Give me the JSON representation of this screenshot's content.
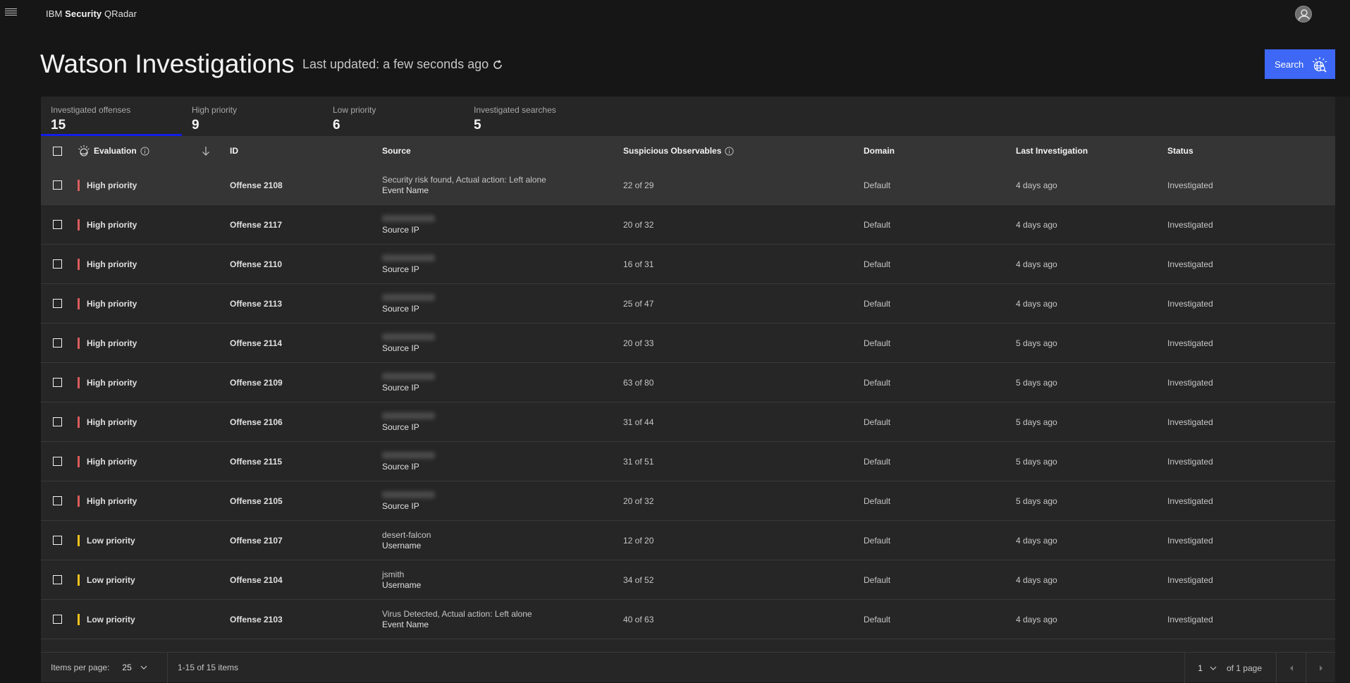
{
  "header": {
    "brand_prefix": "IBM ",
    "brand_bold": "Security",
    "brand_suffix": " QRadar",
    "menu_icon": "hamburger-menu-icon",
    "user_icon": "user-avatar-icon"
  },
  "page": {
    "title": "Watson Investigations",
    "last_updated": "Last updated: a few seconds ago",
    "search_label": "Search"
  },
  "tabs": [
    {
      "label": "Investigated offenses",
      "value": "15",
      "active": true
    },
    {
      "label": "High priority",
      "value": "9",
      "active": false
    },
    {
      "label": "Low priority",
      "value": "6",
      "active": false
    },
    {
      "label": "Investigated searches",
      "value": "5",
      "active": false
    }
  ],
  "table": {
    "columns": {
      "evaluation": "Evaluation",
      "id": "ID",
      "source": "Source",
      "observables": "Suspicious Observables",
      "domain": "Domain",
      "last_investigation": "Last Investigation",
      "status": "Status"
    },
    "colors": {
      "high": "#da5c5c",
      "low": "#f1c21b"
    },
    "rows": [
      {
        "priority": "High priority",
        "level": "high",
        "id": "Offense 2108",
        "source_value": "Security risk found, Actual action: Left alone",
        "source_blurred": false,
        "source_type": "Event Name",
        "observables": "22 of 29",
        "domain": "Default",
        "last": "4 days ago",
        "status": "Investigated"
      },
      {
        "priority": "High priority",
        "level": "high",
        "id": "Offense 2117",
        "source_value": "",
        "source_blurred": true,
        "source_type": "Source IP",
        "observables": "20 of 32",
        "domain": "Default",
        "last": "4 days ago",
        "status": "Investigated"
      },
      {
        "priority": "High priority",
        "level": "high",
        "id": "Offense 2110",
        "source_value": "",
        "source_blurred": true,
        "source_type": "Source IP",
        "observables": "16 of 31",
        "domain": "Default",
        "last": "4 days ago",
        "status": "Investigated"
      },
      {
        "priority": "High priority",
        "level": "high",
        "id": "Offense 2113",
        "source_value": "",
        "source_blurred": true,
        "source_type": "Source IP",
        "observables": "25 of 47",
        "domain": "Default",
        "last": "4 days ago",
        "status": "Investigated"
      },
      {
        "priority": "High priority",
        "level": "high",
        "id": "Offense 2114",
        "source_value": "",
        "source_blurred": true,
        "source_type": "Source IP",
        "observables": "20 of 33",
        "domain": "Default",
        "last": "5 days ago",
        "status": "Investigated"
      },
      {
        "priority": "High priority",
        "level": "high",
        "id": "Offense 2109",
        "source_value": "",
        "source_blurred": true,
        "source_type": "Source IP",
        "observables": "63 of 80",
        "domain": "Default",
        "last": "5 days ago",
        "status": "Investigated"
      },
      {
        "priority": "High priority",
        "level": "high",
        "id": "Offense 2106",
        "source_value": "",
        "source_blurred": true,
        "source_type": "Source IP",
        "observables": "31 of 44",
        "domain": "Default",
        "last": "5 days ago",
        "status": "Investigated"
      },
      {
        "priority": "High priority",
        "level": "high",
        "id": "Offense 2115",
        "source_value": "",
        "source_blurred": true,
        "source_type": "Source IP",
        "observables": "31 of 51",
        "domain": "Default",
        "last": "5 days ago",
        "status": "Investigated"
      },
      {
        "priority": "High priority",
        "level": "high",
        "id": "Offense 2105",
        "source_value": "",
        "source_blurred": true,
        "source_type": "Source IP",
        "observables": "20 of 32",
        "domain": "Default",
        "last": "5 days ago",
        "status": "Investigated"
      },
      {
        "priority": "Low priority",
        "level": "low",
        "id": "Offense 2107",
        "source_value": "desert-falcon",
        "source_blurred": false,
        "source_type": "Username",
        "observables": "12 of 20",
        "domain": "Default",
        "last": "4 days ago",
        "status": "Investigated"
      },
      {
        "priority": "Low priority",
        "level": "low",
        "id": "Offense 2104",
        "source_value": "jsmith",
        "source_blurred": false,
        "source_type": "Username",
        "observables": "34 of 52",
        "domain": "Default",
        "last": "4 days ago",
        "status": "Investigated"
      },
      {
        "priority": "Low priority",
        "level": "low",
        "id": "Offense 2103",
        "source_value": "Virus Detected, Actual action: Left alone",
        "source_blurred": false,
        "source_type": "Event Name",
        "observables": "40 of 63",
        "domain": "Default",
        "last": "4 days ago",
        "status": "Investigated"
      }
    ]
  },
  "pagination": {
    "items_per_page_label": "Items per page:",
    "items_per_page": "25",
    "range": "1-15 of 15 items",
    "page": "1",
    "of_pages": "of 1 page"
  }
}
